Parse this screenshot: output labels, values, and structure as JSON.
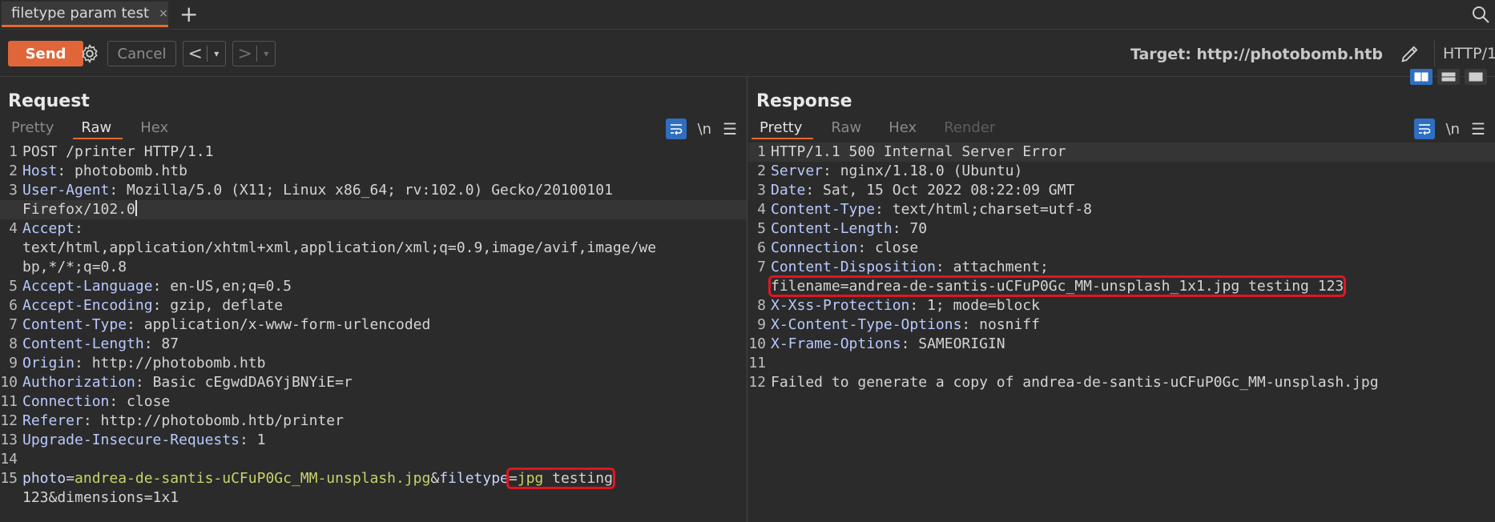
{
  "tab": {
    "title": "filetype param test",
    "close": "×",
    "new": "+"
  },
  "toolbar": {
    "send": "Send",
    "cancel": "Cancel",
    "back": "<",
    "forward": ">",
    "dropdown": "▾",
    "target": "Target: http://photobomb.htb",
    "protocol": "HTTP/1"
  },
  "request": {
    "title": "Request",
    "tabs": [
      "Pretty",
      "Raw",
      "Hex"
    ],
    "active_tab": "Raw",
    "newline_toggle": "\\n",
    "lines": [
      {
        "n": "1",
        "text": "POST /printer HTTP/1.1"
      },
      {
        "n": "2",
        "name": "Host",
        "value": " photobomb.htb"
      },
      {
        "n": "3",
        "name": "User-Agent",
        "value": " Mozilla/5.0 (X11; Linux x86_64; rv:102.0) Gecko/20100101",
        "cont": "Firefox/102.0"
      },
      {
        "n": "4",
        "name": "Accept",
        "value": "",
        "cont": "text/html,application/xhtml+xml,application/xml;q=0.9,image/avif,image/we",
        "cont2": "bp,*/*;q=0.8"
      },
      {
        "n": "5",
        "name": "Accept-Language",
        "value": " en-US,en;q=0.5"
      },
      {
        "n": "6",
        "name": "Accept-Encoding",
        "value": " gzip, deflate"
      },
      {
        "n": "7",
        "name": "Content-Type",
        "value": " application/x-www-form-urlencoded"
      },
      {
        "n": "8",
        "name": "Content-Length",
        "value": " 87"
      },
      {
        "n": "9",
        "name": "Origin",
        "value": " http://photobomb.htb"
      },
      {
        "n": "10",
        "name": "Authorization",
        "value": " Basic cEgwdDA6YjBNYiE=r"
      },
      {
        "n": "11",
        "name": "Connection",
        "value": " close"
      },
      {
        "n": "12",
        "name": "Referer",
        "value": " http://photobomb.htb/printer"
      },
      {
        "n": "13",
        "name": "Upgrade-Insecure-Requests",
        "value": " 1"
      },
      {
        "n": "14",
        "text": ""
      },
      {
        "n": "15",
        "body": {
          "k1": "photo",
          "v1": "andrea-de-santis-uCFuP0Gc_MM-unsplash.jpg",
          "amp": "&",
          "k2": "filetype",
          "eq": "=",
          "v2a": "jpg",
          "v2b": " testing",
          "cont": "123&dimensions=1x1"
        }
      }
    ]
  },
  "response": {
    "title": "Response",
    "tabs": [
      "Pretty",
      "Raw",
      "Hex",
      "Render"
    ],
    "active_tab": "Pretty",
    "newline_toggle": "\\n",
    "lines": [
      {
        "n": "1",
        "text": "HTTP/1.1 500 Internal Server Error"
      },
      {
        "n": "2",
        "name": "Server",
        "value": " nginx/1.18.0 (Ubuntu)"
      },
      {
        "n": "3",
        "name": "Date",
        "value": " Sat, 15 Oct 2022 08:22:09 GMT"
      },
      {
        "n": "4",
        "name": "Content-Type",
        "value": " text/html;charset=utf-8"
      },
      {
        "n": "5",
        "name": "Content-Length",
        "value": " 70"
      },
      {
        "n": "6",
        "name": "Connection",
        "value": " close"
      },
      {
        "n": "7",
        "name": "Content-Disposition",
        "value": " attachment;",
        "cont": "filename=andrea-de-santis-uCFuP0Gc_MM-unsplash_1x1.jpg testing 123"
      },
      {
        "n": "8",
        "name": "X-Xss-Protection",
        "value": " 1; mode=block"
      },
      {
        "n": "9",
        "name": "X-Content-Type-Options",
        "value": " nosniff"
      },
      {
        "n": "10",
        "name": "X-Frame-Options",
        "value": " SAMEORIGIN"
      },
      {
        "n": "11",
        "text": ""
      },
      {
        "n": "12",
        "text": "Failed to generate a copy of andrea-de-santis-uCFuP0Gc_MM-unsplash.jpg"
      }
    ]
  }
}
